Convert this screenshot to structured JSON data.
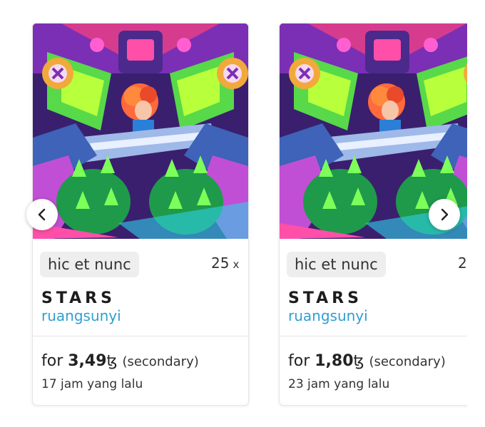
{
  "cards": [
    {
      "platform": "hic et nunc",
      "edition": "25",
      "edition_suffix": "x",
      "title": "STARS",
      "artist": "ruangsunyi",
      "price_prefix": "for",
      "price_value": "3,49",
      "currency": "ꜩ",
      "price_kind": "(secondary)",
      "time_ago": "17 jam yang lalu"
    },
    {
      "platform": "hic et nunc",
      "edition": "2",
      "edition_suffix": "",
      "title": "STARS",
      "artist": "ruangsunyi",
      "price_prefix": "for",
      "price_value": "1,80",
      "currency": "ꜩ",
      "price_kind": "(secondary)",
      "time_ago": "23 jam yang lalu"
    }
  ],
  "nav": {
    "prev_icon": "chevron-left-icon",
    "next_icon": "chevron-right-icon"
  },
  "colors": {
    "artist_link": "#2f9fd1",
    "tag_background": "#eeeeee",
    "card_border": "#e6e6e6"
  }
}
